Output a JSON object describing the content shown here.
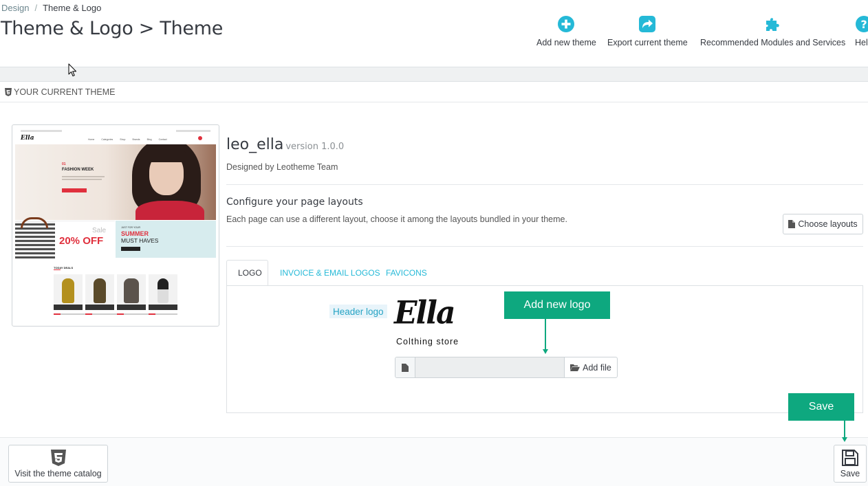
{
  "breadcrumb": {
    "parent": "Design",
    "separator": "/",
    "current": "Theme & Logo"
  },
  "page_title": "Theme & Logo > Theme",
  "toolbar": {
    "add_theme": "Add new theme",
    "export_theme": "Export current theme",
    "recommended": "Recommended Modules and Services",
    "help": "Help"
  },
  "section": {
    "title": "YOUR CURRENT THEME"
  },
  "theme": {
    "name": "leo_ella",
    "version": "version 1.0.0",
    "designed_by": "Designed by Leotheme Team"
  },
  "layouts": {
    "title": "Configure your page layouts",
    "description": "Each page can use a different layout, choose it among the layouts bundled in your theme.",
    "button": "Choose layouts"
  },
  "tabs": [
    {
      "label": "LOGO",
      "active": true
    },
    {
      "label": "INVOICE & EMAIL LOGOS",
      "active": false
    },
    {
      "label": "FAVICONS",
      "active": false
    }
  ],
  "logo": {
    "label": "Header logo",
    "brand": "Ella",
    "tagline": "Colthing store",
    "add_file": "Add file",
    "file_value": ""
  },
  "callouts": {
    "add_logo": "Add new logo",
    "save": "Save"
  },
  "footer": {
    "catalog": "Visit the theme catalog",
    "save": "Save"
  },
  "preview": {
    "logo": "Ella",
    "nav": [
      "Home",
      "Categories",
      "Shop",
      "Brands",
      "Blog",
      "Contact"
    ],
    "hero_number": "01",
    "hero_title": "FASHION WEEK",
    "sale_word": "Sale",
    "sale_text": "20% OFF",
    "summer_kicker": "JUST FOR YOUR",
    "summer_title": "SUMMER",
    "summer_sub": "MUST HAVES",
    "deals_title": "TODAY DEALS"
  },
  "colors": {
    "accent": "#25b9d7",
    "callout": "#0ea87f",
    "text": "#363a41",
    "sale_red": "#e0303d"
  }
}
